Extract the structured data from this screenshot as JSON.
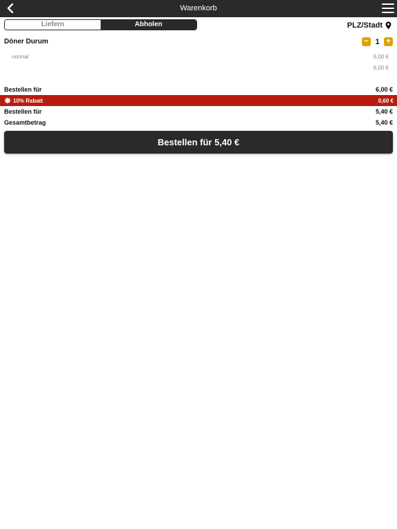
{
  "header": {
    "title": "Warenkorb",
    "back_icon": "chevron-left-icon",
    "menu_icon": "hamburger-menu-icon"
  },
  "order_type": {
    "options": [
      {
        "label": "Liefern",
        "selected": false
      },
      {
        "label": "Abholen",
        "selected": true
      }
    ]
  },
  "location": {
    "label": "PLZ/Stadt",
    "icon": "map-pin-icon"
  },
  "cart": {
    "items": [
      {
        "name": "Döner Durum",
        "quantity": "1",
        "decrement_label": "−",
        "increment_label": "+",
        "variant": "normal",
        "variant_price": "6,00 €",
        "item_total": "6,00 €"
      }
    ]
  },
  "summary": {
    "subtotal_label": "Bestellen für",
    "subtotal_value": "6,00 €",
    "discount_label": "10% Rabatt",
    "discount_value": "0,60 €",
    "discount_icon": "badge-star-icon",
    "after_discount_label": "Bestellen für",
    "after_discount_value": "5,40 €",
    "total_label": "Gesamtbetrag",
    "total_value": "5,40 €"
  },
  "order_button": {
    "label": "Bestellen für 5,40 €"
  },
  "colors": {
    "header_bg": "#2a2a2a",
    "accent": "#e0a106",
    "discount_bg": "#b81c10"
  }
}
